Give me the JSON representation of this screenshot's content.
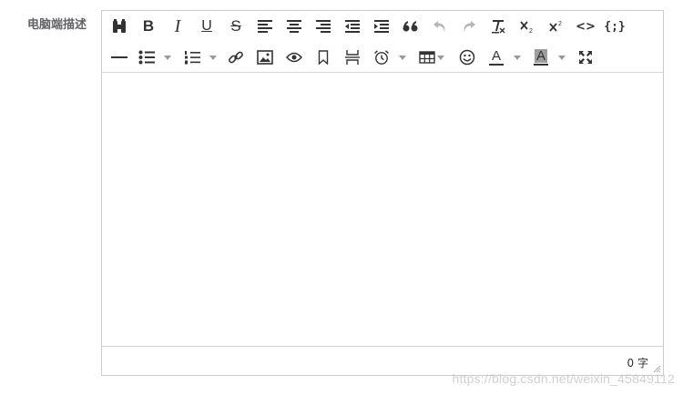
{
  "form": {
    "label": "电脑端描述"
  },
  "editor": {
    "toolbar": {
      "row1": [
        {
          "name": "find-replace",
          "icon": "binoculars-icon"
        },
        {
          "name": "bold",
          "icon": "bold-icon",
          "text": "B"
        },
        {
          "name": "italic",
          "icon": "italic-icon",
          "text": "I"
        },
        {
          "name": "underline",
          "icon": "underline-icon",
          "text": "U"
        },
        {
          "name": "strikethrough",
          "icon": "strikethrough-icon",
          "text": "S"
        },
        {
          "name": "align-left",
          "icon": "align-left-icon"
        },
        {
          "name": "align-center",
          "icon": "align-center-icon"
        },
        {
          "name": "align-right",
          "icon": "align-right-icon"
        },
        {
          "name": "outdent",
          "icon": "outdent-icon"
        },
        {
          "name": "indent",
          "icon": "indent-icon"
        },
        {
          "name": "blockquote",
          "icon": "quote-icon"
        },
        {
          "name": "undo",
          "icon": "undo-icon",
          "disabled": true
        },
        {
          "name": "redo",
          "icon": "redo-icon",
          "disabled": true
        },
        {
          "name": "remove-format",
          "icon": "clear-format-icon"
        },
        {
          "name": "subscript",
          "icon": "subscript-icon"
        },
        {
          "name": "superscript",
          "icon": "superscript-icon"
        },
        {
          "name": "code",
          "icon": "code-icon",
          "text": "<>"
        },
        {
          "name": "code-sample",
          "icon": "code-sample-icon",
          "text": "{;}"
        }
      ],
      "row2": [
        {
          "name": "horizontal-rule",
          "icon": "hr-icon"
        },
        {
          "name": "bullet-list",
          "icon": "bullet-list-icon",
          "dropdown": true
        },
        {
          "name": "numbered-list",
          "icon": "numbered-list-icon",
          "dropdown": true
        },
        {
          "name": "link",
          "icon": "link-icon"
        },
        {
          "name": "image",
          "icon": "image-icon"
        },
        {
          "name": "preview",
          "icon": "eye-icon"
        },
        {
          "name": "anchor",
          "icon": "bookmark-icon"
        },
        {
          "name": "page-break",
          "icon": "page-break-icon"
        },
        {
          "name": "insert-datetime",
          "icon": "alarm-clock-icon",
          "dropdown": true
        },
        {
          "name": "table",
          "icon": "table-icon",
          "dropdown": true
        },
        {
          "name": "emoticons",
          "icon": "smiley-icon"
        },
        {
          "name": "text-color",
          "icon": "text-color-icon",
          "text": "A",
          "dropdown": true
        },
        {
          "name": "background-color",
          "icon": "background-color-icon",
          "text": "A",
          "dropdown": true
        },
        {
          "name": "fullscreen",
          "icon": "fullscreen-icon"
        }
      ]
    },
    "content": "",
    "word_count": "0 字"
  },
  "watermark": "https://blog.csdn.net/weixin_45849112",
  "colors": {
    "border": "#cccccc",
    "icon": "#333333",
    "icon_disabled": "#b5b5b5",
    "label": "#606266",
    "highlight_bg": "#9e9e9e"
  }
}
